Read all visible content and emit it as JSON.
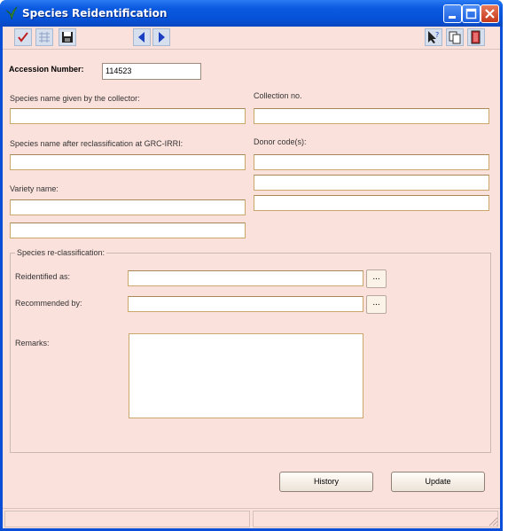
{
  "window": {
    "title": "Species Reidentification"
  },
  "accession": {
    "label": "Accession Number:",
    "value": "114523"
  },
  "fields": {
    "collector_name_label": "Species name given by the collector:",
    "collection_no_label": "Collection no.",
    "reclass_name_label": "Species name after reclassification at GRC-IRRI:",
    "donor_code_label": "Donor code(s):",
    "variety_name_label": "Variety name:"
  },
  "reclassification": {
    "group_label": "Species re-classification:",
    "reidentified_label": "Reidentified as:",
    "recommended_label": "Recommended by:",
    "remarks_label": "Remarks:",
    "browse_label": "..."
  },
  "buttons": {
    "history": "History",
    "update": "Update"
  },
  "toolbar_icons": [
    "check-icon",
    "grid-icon",
    "save-icon",
    "prev-icon",
    "next-icon",
    "help-cursor-icon",
    "copy-icon",
    "exit-icon"
  ]
}
